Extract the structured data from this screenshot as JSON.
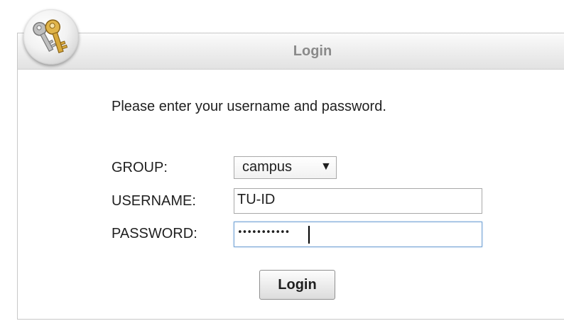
{
  "header": {
    "title": "Login",
    "icon": "keys-icon"
  },
  "form": {
    "prompt": "Please enter your username and password.",
    "group": {
      "label": "GROUP:",
      "selected": "campus",
      "arrow": "▼"
    },
    "username": {
      "label": "USERNAME:",
      "value": "TU-ID"
    },
    "password": {
      "label": "PASSWORD:",
      "masked_value": "•••••••••••"
    },
    "submit_label": "Login"
  },
  "colors": {
    "border": "#c8c8c8",
    "title_text": "#8a8a8a",
    "focus_border": "#7aa7d6",
    "key_gold": "#d8a93c"
  }
}
